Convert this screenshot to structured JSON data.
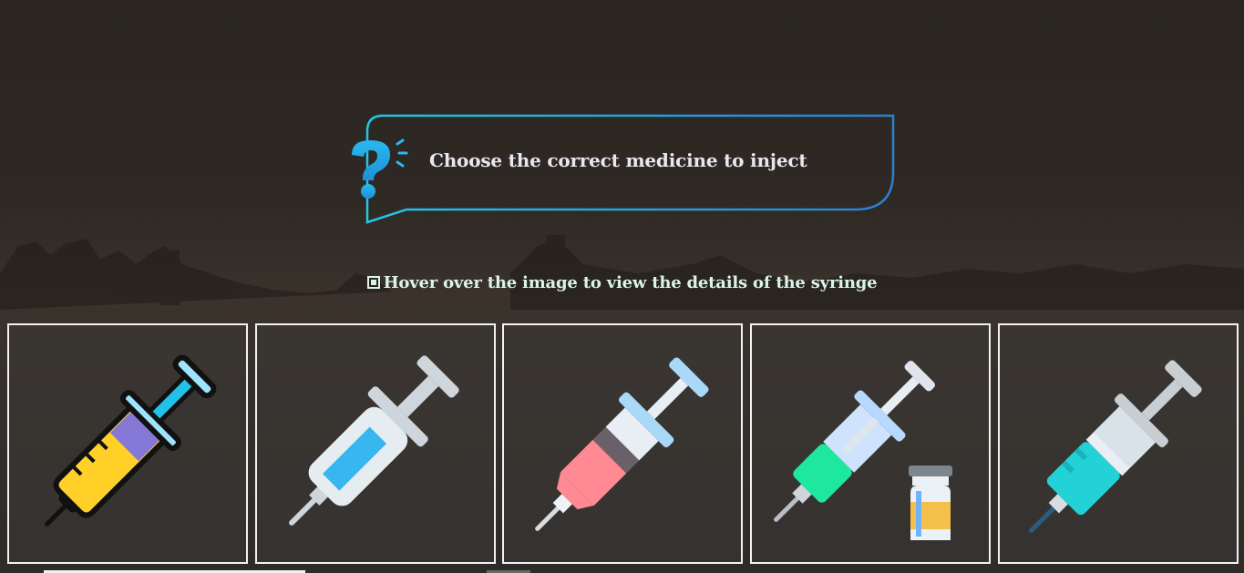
{
  "question": {
    "text": "Choose the correct medicine to inject",
    "icon": "question-mark-icon"
  },
  "hint": {
    "icon": "image-icon",
    "text": "Hover over the image to view the details of the syringe"
  },
  "options": [
    {
      "name": "syringe-yellow-outline",
      "icon": "syringe-icon",
      "fluid_color": "#ffd028"
    },
    {
      "name": "syringe-blue-flat",
      "icon": "syringe-icon",
      "fluid_color": "#3bb3ef"
    },
    {
      "name": "syringe-red",
      "icon": "syringe-icon",
      "fluid_color": "#ff8a93"
    },
    {
      "name": "syringe-green-with-vial",
      "icon": "syringe-icon",
      "fluid_color": "#1ee8a0"
    },
    {
      "name": "syringe-teal",
      "icon": "syringe-icon",
      "fluid_color": "#22d2d6"
    }
  ],
  "colors": {
    "frame_gradient_start": "#22c6e8",
    "frame_gradient_end": "#2a7fd0",
    "card_border": "#f2f2f2",
    "hint_text": "#d9f5e8"
  }
}
